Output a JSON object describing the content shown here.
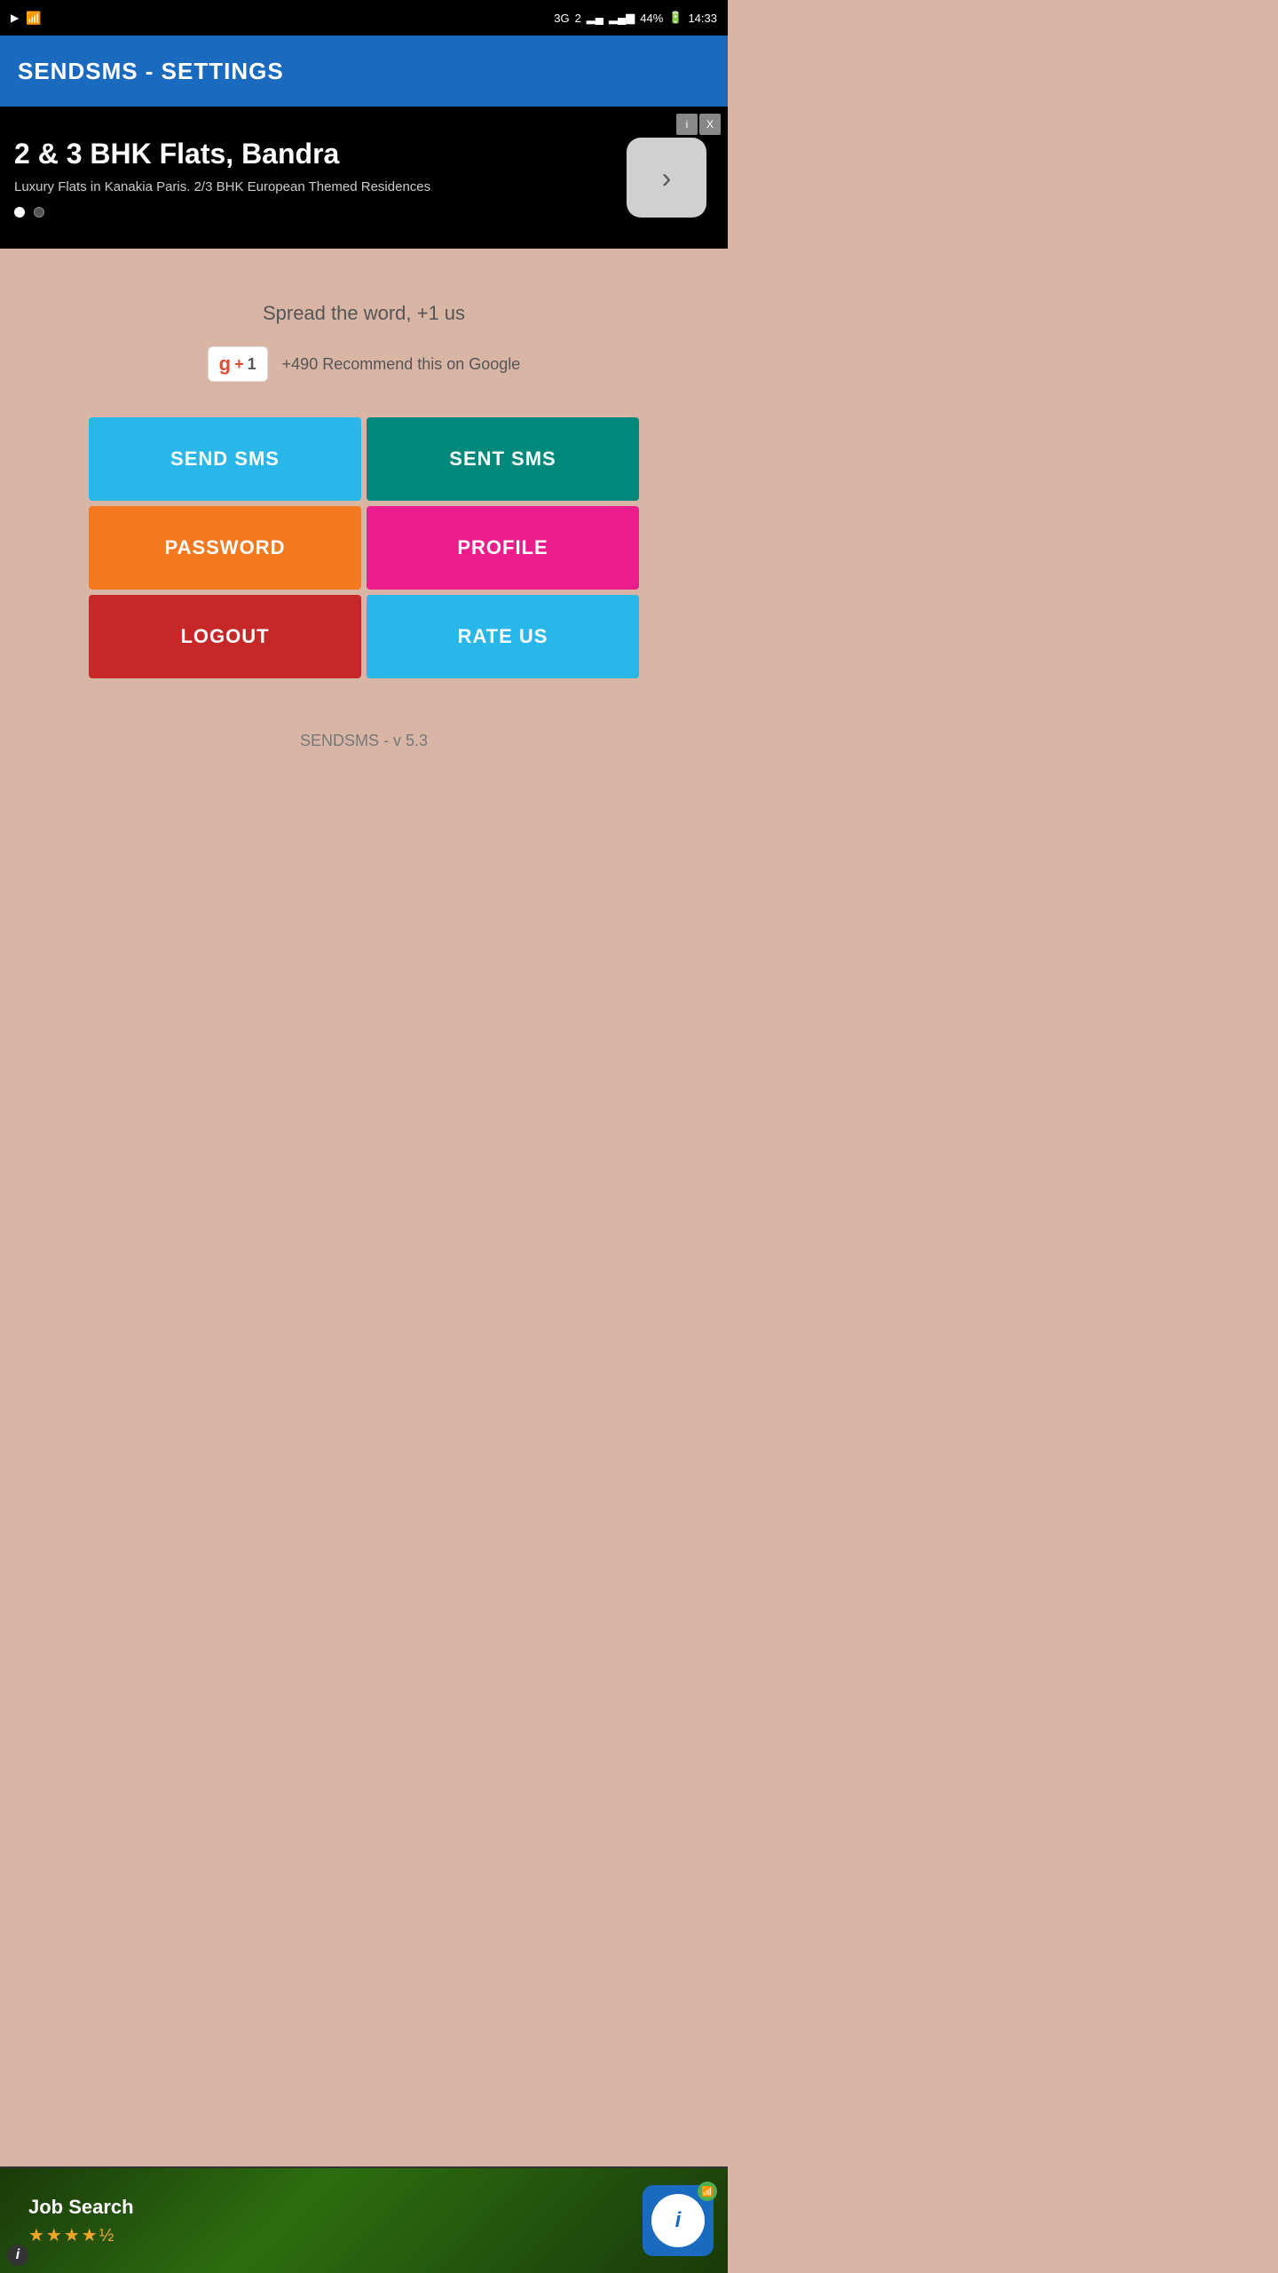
{
  "statusBar": {
    "network": "3G",
    "sim": "2",
    "battery": "44%",
    "time": "14:33"
  },
  "appBar": {
    "title": "SENDSMS - SETTINGS"
  },
  "ad": {
    "title": "2 & 3 BHK Flats, Bandra",
    "subtitle": "Luxury Flats in Kanakia Paris. 2/3 BHK European Themed Residences",
    "arrowLabel": "›",
    "infoLabel": "i",
    "closeLabel": "X"
  },
  "main": {
    "spreadText": "Spread the word, +1 us",
    "gplusCount": "+490 Recommend this on Google",
    "gplusLabel": "g+1"
  },
  "buttons": {
    "sendSms": "SEND SMS",
    "sentSms": "SENT SMS",
    "password": "PASSWORD",
    "profile": "PROFILE",
    "logout": "LOGOUT",
    "rateUs": "RATE US"
  },
  "version": "SENDSMS - v 5.3",
  "bottomAd": {
    "title": "Job Search",
    "stars": "★★★★½",
    "infoLabel": "i"
  },
  "colors": {
    "appBar": "#1a6bbf",
    "background": "#d9b5a5",
    "sendSms": "#29b6e8",
    "sentSms": "#00897b",
    "password": "#f47920",
    "profile": "#e91e8c",
    "logout": "#c62828",
    "rateUs": "#29b6e8"
  }
}
